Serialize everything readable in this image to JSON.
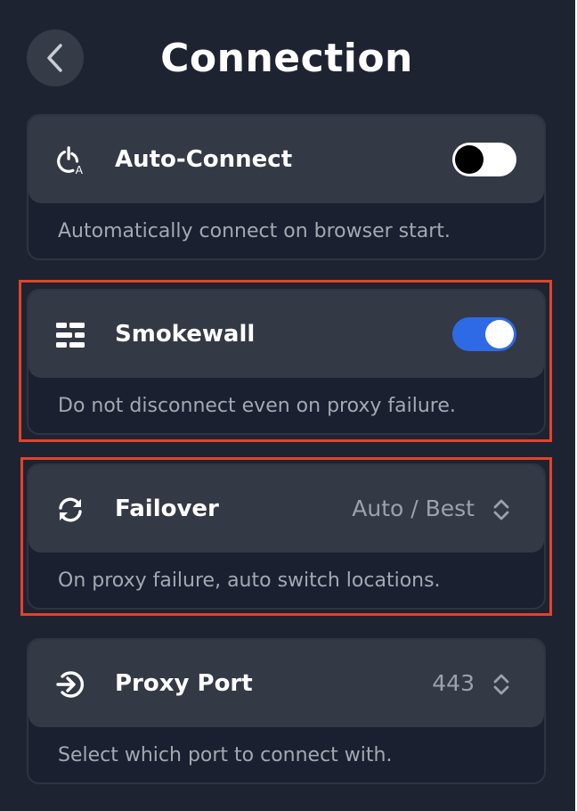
{
  "header": {
    "title": "Connection",
    "back_icon": "chevron-left-icon"
  },
  "settings": [
    {
      "icon": "auto-connect-power-icon",
      "label": "Auto-Connect",
      "control": "toggle",
      "enabled": false,
      "description": "Automatically connect on browser start."
    },
    {
      "icon": "firewall-bricks-icon",
      "label": "Smokewall",
      "control": "toggle",
      "enabled": true,
      "description": "Do not disconnect even on proxy failure."
    },
    {
      "icon": "refresh-cycle-icon",
      "label": "Failover",
      "control": "select",
      "value": "Auto / Best",
      "description": "On proxy failure, auto switch locations."
    },
    {
      "icon": "sign-in-arrow-icon",
      "label": "Proxy Port",
      "control": "select",
      "value": "443",
      "description": "Select which port to connect with."
    }
  ],
  "colors": {
    "background": "#1e2331",
    "card_row": "#343946",
    "toggle_on": "#2e6ae6",
    "highlight": "#e2432a"
  }
}
